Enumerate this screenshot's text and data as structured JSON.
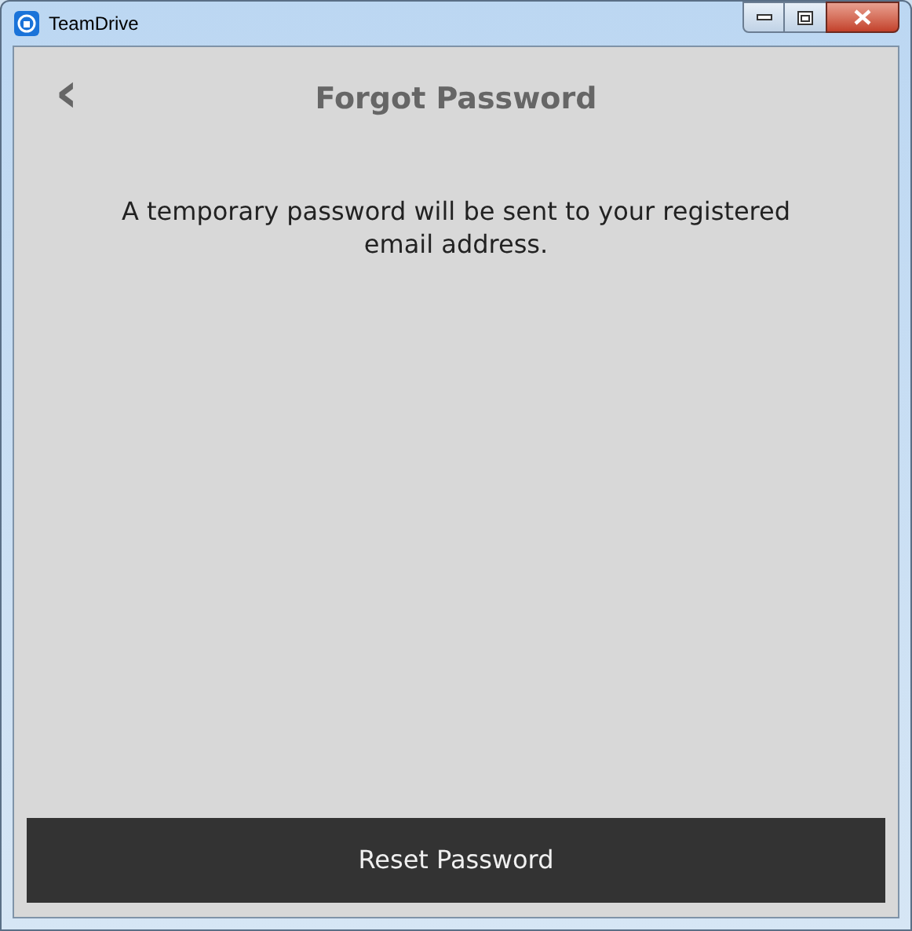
{
  "window": {
    "title": "TeamDrive"
  },
  "header": {
    "back": "‹",
    "title": "Forgot Password"
  },
  "message": "A temporary password will be sent to your registered email address.",
  "button": "Reset Password"
}
